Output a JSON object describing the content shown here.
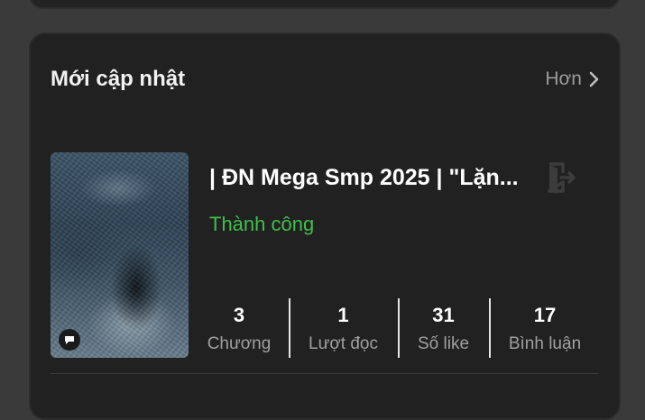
{
  "section": {
    "title": "Mới cập nhật",
    "more_label": "Hơn",
    "more_icon": "chevron-right-icon"
  },
  "story": {
    "title": "| ĐN Mega Smp 2025 | \"Lặn...",
    "status": "Thành công",
    "status_color": "#3fbf4a",
    "cover_badge_icon": "chat-bubble-icon",
    "action_icon": "exit-icon"
  },
  "stats": [
    {
      "value": "3",
      "label": "Chương"
    },
    {
      "value": "1",
      "label": "Lượt đọc"
    },
    {
      "value": "31",
      "label": "Số like"
    },
    {
      "value": "17",
      "label": "Bình luận"
    }
  ]
}
